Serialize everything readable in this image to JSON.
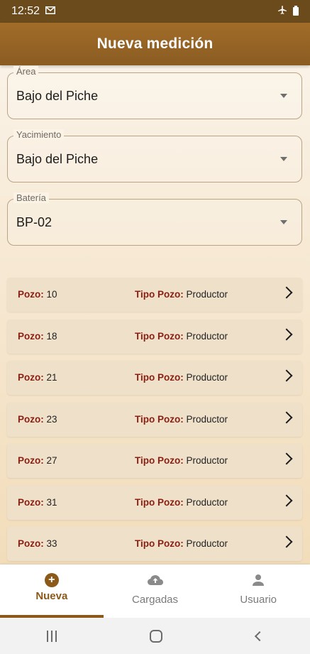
{
  "status_bar": {
    "time": "12:52",
    "notification_icon": "gmail-icon",
    "airplane_icon": "airplane-icon",
    "battery_icon": "battery-icon"
  },
  "app_bar": {
    "title": "Nueva medición"
  },
  "fields": [
    {
      "label": "Área",
      "value": "Bajo del Piche"
    },
    {
      "label": "Yacimiento",
      "value": "Bajo del Piche"
    },
    {
      "label": "Batería",
      "value": "BP-02"
    }
  ],
  "list": {
    "pozo_label": "Pozo:",
    "tipo_label": "Tipo Pozo:",
    "rows": [
      {
        "pozo": "10",
        "tipo": "Productor"
      },
      {
        "pozo": "18",
        "tipo": "Productor"
      },
      {
        "pozo": "21",
        "tipo": "Productor"
      },
      {
        "pozo": "23",
        "tipo": "Productor"
      },
      {
        "pozo": "27",
        "tipo": "Productor"
      },
      {
        "pozo": "31",
        "tipo": "Productor"
      },
      {
        "pozo": "33",
        "tipo": "Productor"
      }
    ]
  },
  "bottom_nav": {
    "items": [
      {
        "label": "Nueva",
        "icon": "add-circle-icon",
        "active": true
      },
      {
        "label": "Cargadas",
        "icon": "cloud-upload-icon",
        "active": false
      },
      {
        "label": "Usuario",
        "icon": "person-icon",
        "active": false
      }
    ]
  },
  "colors": {
    "primary": "#8b5a1b",
    "accent_label": "#8b1e12",
    "status_bar": "#6b4b1c"
  }
}
